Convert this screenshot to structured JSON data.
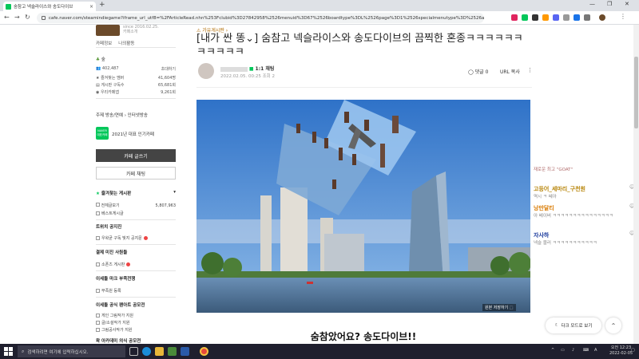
{
  "browser": {
    "tab_title": "숨참고 넥슬라이스와 송도다이브",
    "tab_close": "×",
    "new_tab": "+",
    "url": "cafe.naver.com/steamindiegame?iframe_url_utf8=%2FArticleRead.nhn%253Fclubid%3D27842958%2526menuid%3D67%2526boardtype%3DL%2526page%3D1%2526specialmenutype%3D%2526articleid%3D"
  },
  "sidebar": {
    "since": "since 2016.02.25.",
    "cafe_intro": "카페소개",
    "tabs": [
      "카페정보",
      "나의활동"
    ],
    "member_grade": "숲",
    "stats": [
      {
        "label": "402,487",
        "value": "초대하기"
      },
      {
        "label": "즐겨찾는 멤버",
        "value": "41,604명"
      },
      {
        "label": "게시판 구독수",
        "value": "65,681회"
      },
      {
        "label": "우리카페앱",
        "value": "9,261회"
      }
    ],
    "topics": "주제  방송/연예 › 인터넷방송",
    "badge_icon": "NAVER 대표카페",
    "badge_text": "2021년 대표 인기카페",
    "write_button": "카페 글쓰기",
    "chat_button": "카페 채팅",
    "favorites_head": "즐겨찾는 게시판",
    "boards": [
      {
        "name": "전체글보기",
        "count": "5,807,963"
      },
      {
        "name": "베스트게시글",
        "count": ""
      }
    ],
    "section1": "트위치 공지진",
    "section1_item": "우왁굳 구독 빛지 공지문",
    "section2": "결제 미진 사원들",
    "section2_item": "소폰즈 게시판",
    "section3": "이세돌 마크 부족전쟁",
    "section3_item": "부족원 등록",
    "section4": "이세돌 공식 팬아트 공모전",
    "section4_items": [
      "게인 그림작가 지원",
      "글/소설작가 지원",
      "그림공사작가 지원"
    ],
    "section5": "왁 아카데미 의식 공모전"
  },
  "article": {
    "board_tag": "⚠ 가유게시판 ›",
    "title": "[내가 싼 똥⌄] 숨참고 넥슬라이스와 송도다이브의 끔찍한 혼종ㅋㅋㅋㅋㅋㅋㅋㅋㅋㅋㅋ",
    "author_grade": "1:1 채팅",
    "date": "2022.02.05. 00:25  조회 2",
    "comments": "◯ 댓글 0",
    "url_copy": "URL 복사",
    "more": "⋮",
    "photo_caption": "원본 저장하기 ⬚",
    "subheading": "숨참았어요? 송도다이브!!"
  },
  "chat": {
    "system_msg": "재로운 최고 \"GOAT\"",
    "entries": [
      {
        "name": "고등어_세마리_구천원",
        "message": "역시 ㅋ 쎄아",
        "color": "#b8860b"
      },
      {
        "name": "낭만달티",
        "message": "아 베이버 ㅋㅋㅋㅋㅋㅋㅋㅋㅋㅋㅋㅋㅋㅋㅋ",
        "color": "#d97a00"
      },
      {
        "name": "자사하",
        "message": "넥슬 블러 ㅋㅋㅋㅋㅋㅋㅋㅋㅋㅋㅋ",
        "color": "#1a3a9c"
      }
    ]
  },
  "floating": {
    "dark_mode": "다크 모드로 보기",
    "top": "⌃"
  },
  "taskbar": {
    "search_placeholder": "검색하려면 여기에 입력하십시오.",
    "clock_time": "오전 12:23",
    "clock_date": "2022-02-05",
    "lang": "A"
  },
  "colors": {
    "naver_green": "#03c75a",
    "sidebar_dark_button": "#444444",
    "taskbar": "#1f1f2e"
  }
}
